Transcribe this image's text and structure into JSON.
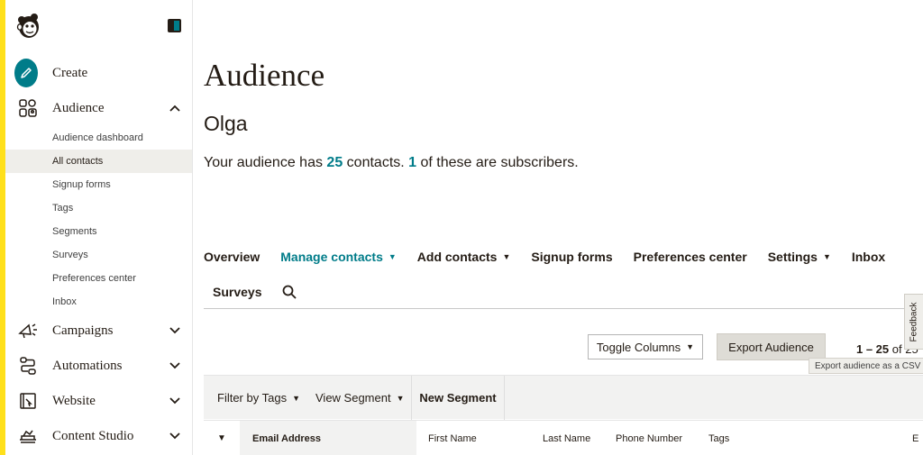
{
  "sidebar": {
    "nav": {
      "create": "Create",
      "audience": "Audience",
      "campaigns": "Campaigns",
      "automations": "Automations",
      "website": "Website",
      "content_studio": "Content Studio"
    },
    "audience_sub": [
      {
        "label": "Audience dashboard"
      },
      {
        "label": "All contacts",
        "active": true
      },
      {
        "label": "Signup forms"
      },
      {
        "label": "Tags"
      },
      {
        "label": "Segments"
      },
      {
        "label": "Surveys"
      },
      {
        "label": "Preferences center"
      },
      {
        "label": "Inbox"
      }
    ]
  },
  "main": {
    "title": "Audience",
    "audience_name": "Olga",
    "summary": {
      "prefix": "Your audience has",
      "contacts_count": "25",
      "middle": "contacts.",
      "subscribers_count": "1",
      "suffix": "of these are subscribers."
    },
    "tabs": [
      {
        "label": "Overview"
      },
      {
        "label": "Manage contacts",
        "active": true,
        "dropdown": true
      },
      {
        "label": "Add contacts",
        "dropdown": true
      },
      {
        "label": "Signup forms"
      },
      {
        "label": "Preferences center"
      },
      {
        "label": "Settings",
        "dropdown": true
      },
      {
        "label": "Inbox"
      },
      {
        "label": "Surveys"
      }
    ],
    "toolbar": {
      "toggle_columns": "Toggle Columns",
      "export_audience": "Export Audience",
      "pager_range": "1 – 25",
      "pager_of": "of 25",
      "export_tooltip": "Export audience as a CSV file"
    },
    "filters": {
      "filter_by_tags": "Filter by Tags",
      "view_segment": "View Segment",
      "new_segment": "New Segment"
    },
    "table": {
      "columns": [
        "Email Address",
        "First Name",
        "Last Name",
        "Phone Number",
        "Tags",
        "E"
      ]
    }
  },
  "feedback_label": "Feedback",
  "colors": {
    "accent": "#007c89",
    "brand_yellow": "#ffe01b",
    "text": "#241c15"
  }
}
